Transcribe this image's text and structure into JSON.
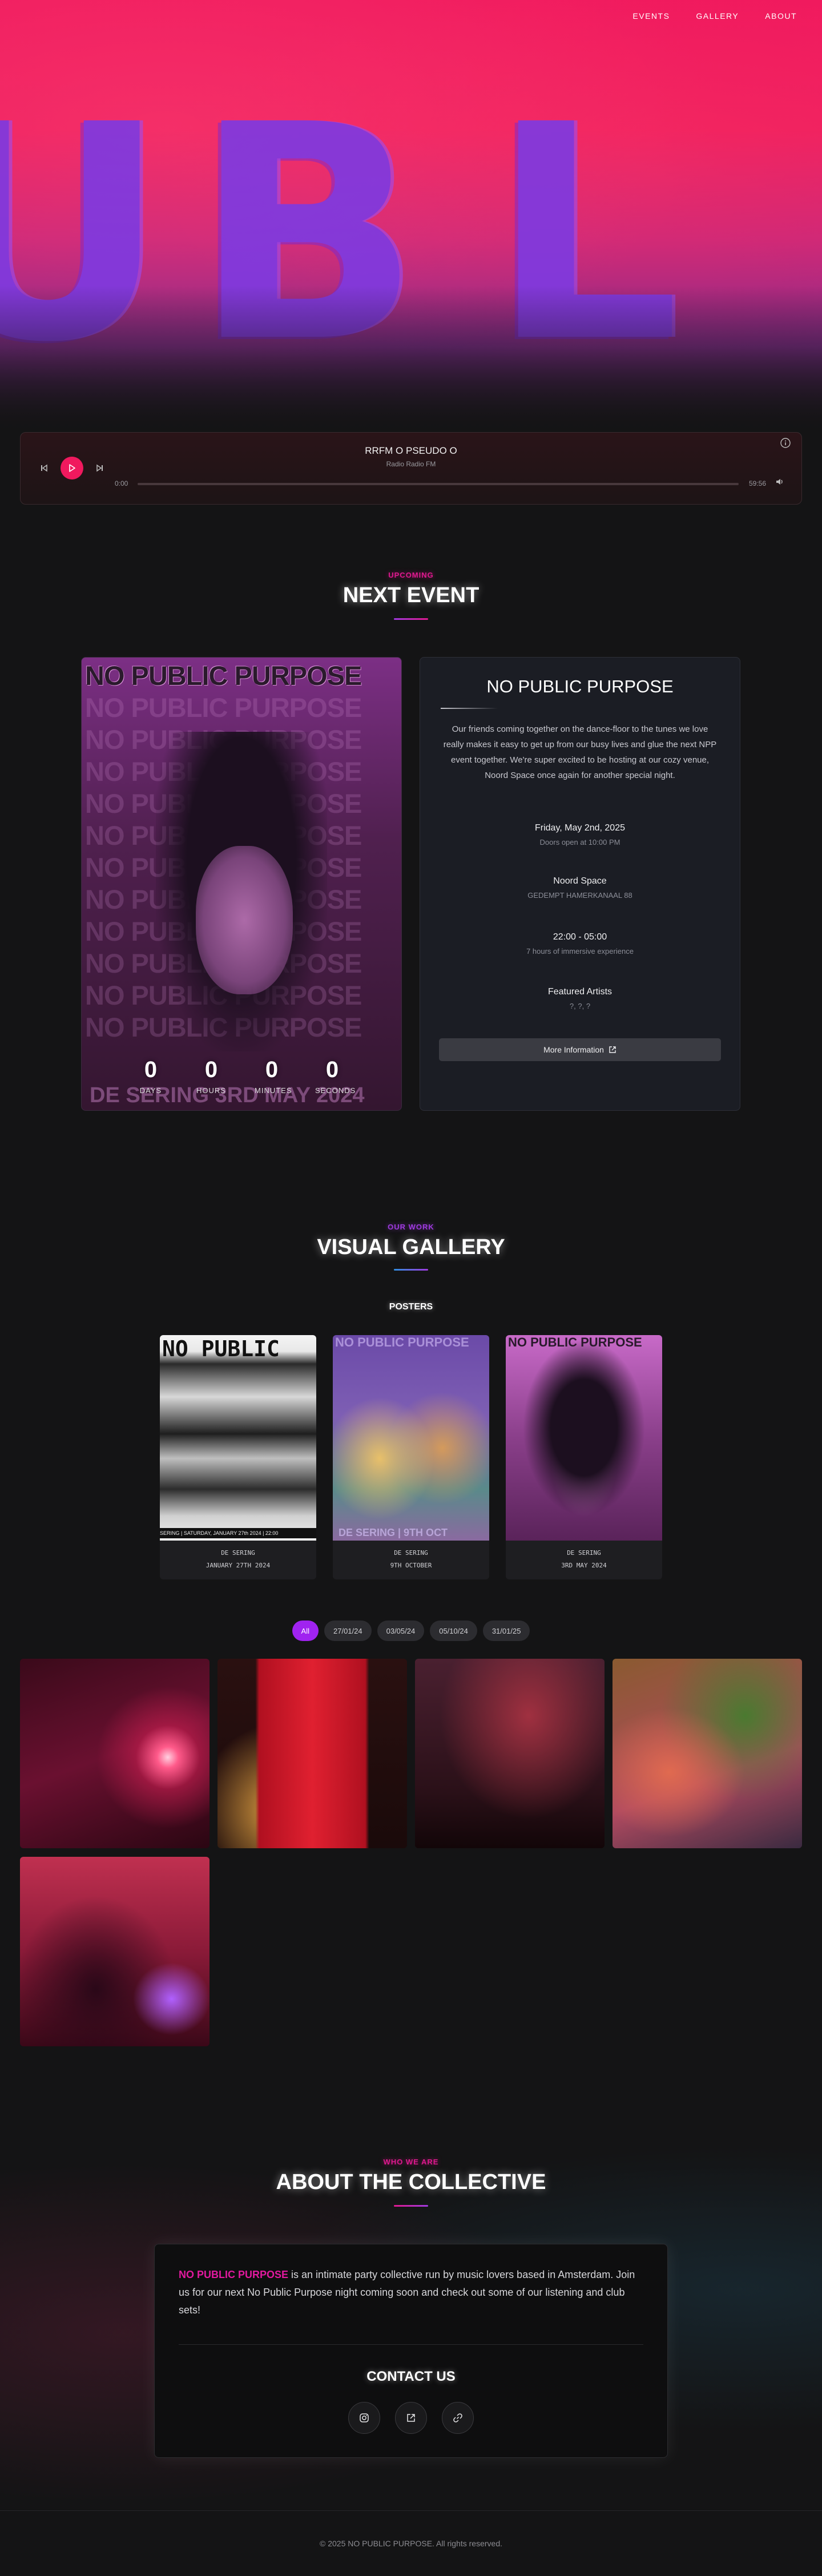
{
  "nav": {
    "items": [
      "EVENTS",
      "GALLERY",
      "ABOUT"
    ]
  },
  "hero": {
    "letters": "UBL"
  },
  "player": {
    "title": "RRFM O PSEUDO O",
    "station": "Radio Radio FM",
    "time_current": "0:00",
    "time_total": "59:56",
    "progress": 0,
    "accent": "#f0195e"
  },
  "event_section": {
    "kicker": "UPCOMING",
    "title": "NEXT EVENT",
    "poster": {
      "headline": "NO PUBLIC PURPOSE",
      "repeat_text": "NO PUBLIC PURPOSE",
      "footer_text": "DE SERING 3RD MAY 2024"
    },
    "countdown": [
      {
        "value": "0",
        "label": "DAYS"
      },
      {
        "value": "0",
        "label": "HOURS"
      },
      {
        "value": "0",
        "label": "MINUTES"
      },
      {
        "value": "0",
        "label": "SECONDS"
      }
    ],
    "card": {
      "title": "NO PUBLIC PURPOSE",
      "description": "Our friends coming together on the dance-floor to the tunes we love really makes it easy to get up from our busy lives and glue the next NPP event together. We're super excited to be hosting at our cozy venue, Noord Space once again for another special night.",
      "date": "Friday, May 2nd, 2025",
      "doors": "Doors open at 10:00 PM",
      "venue": "Noord Space",
      "address": "GEDEMPT HAMERKANAAL 88",
      "time": "22:00 - 05:00",
      "duration": "7 hours of immersive experience",
      "artists_label": "Featured Artists",
      "artists": "?, ?, ?",
      "button": "More Information"
    }
  },
  "gallery_section": {
    "kicker": "OUR WORK",
    "title": "VISUAL GALLERY",
    "posters_label": "POSTERS",
    "posters": [
      {
        "caption1": "DE SERING",
        "caption2": "JANUARY 27TH 2024",
        "art_text": "NO PUBLIC",
        "strip_text": "SERING | SATURDAY, JANUARY 27th 2024 | 22:00"
      },
      {
        "caption1": "DE SERING",
        "caption2": "9TH OCTOBER",
        "art_text": "NO PUBLIC PURPOSE",
        "strip_text": "DE SERING | 9TH OCT"
      },
      {
        "caption1": "DE SERING",
        "caption2": "3RD MAY 2024",
        "art_text": "NO PUBLIC PURPOSE",
        "strip_text": ""
      }
    ],
    "filters": [
      "All",
      "27/01/24",
      "03/05/24",
      "05/10/24",
      "31/01/25"
    ],
    "active_filter": "All"
  },
  "about_section": {
    "kicker": "WHO WE ARE",
    "title": "ABOUT THE COLLECTIVE",
    "brand": "NO PUBLIC PURPOSE",
    "text": " is an intimate party collective run by music lovers based in Amsterdam. Join us for our next No Public Purpose night coming soon and check out some of our listening and club sets!",
    "contact_title": "CONTACT US",
    "socials": [
      "instagram-icon",
      "external-link-icon",
      "link-icon"
    ]
  },
  "footer": {
    "text": "© 2025 NO PUBLIC PURPOSE. All rights reserved."
  },
  "colors": {
    "accent_pink": "#f0195e",
    "accent_purple": "#a023f0",
    "brand_magenta": "#e2199f"
  }
}
